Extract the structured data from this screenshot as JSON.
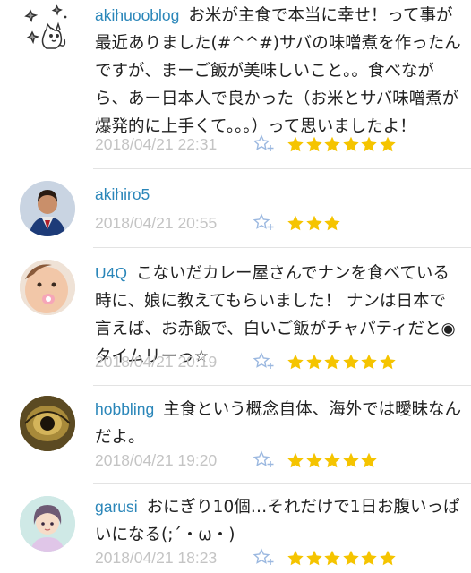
{
  "colors": {
    "username": "#2a86b9",
    "date": "#c4c4c4",
    "star": "#f5c400",
    "star_add": "#9bb8e0",
    "divider": "#e3e3e3"
  },
  "icons": {
    "add_star": "star-plus-icon",
    "rating_star": "star-icon"
  },
  "comments": [
    {
      "username": "akihuooblog",
      "text": "お米が主食で本当に幸せ！って事が最近ありました(#^^#)サバの味噌煮を作ったんですが、まーご飯が美味しいこと。。食べながら、あー日本人で良かった（お米とサバ味噌煮が爆発的に上手くて。。。）って思いましたよ！",
      "date": "2018/04/21 22:31",
      "stars": 6
    },
    {
      "username": "akihiro5",
      "text": "",
      "date": "2018/04/21 20:55",
      "stars": 3
    },
    {
      "username": "U4Q",
      "text": "こないだカレー屋さんでナンを食べている時に、娘に教えてもらいました！ ナンは日本で言えば、お赤飯で、白いご飯がチャパティだと◉ タイムリーっ☆",
      "date": "2018/04/21 20:19",
      "stars": 6
    },
    {
      "username": "hobbling",
      "text": "主食という概念自体、海外では曖昧なんだよ。",
      "date": "2018/04/21 19:20",
      "stars": 5
    },
    {
      "username": "garusi",
      "text": "おにぎり10個…それだけで1日お腹いっぱいになる(;´・ω・)",
      "date": "2018/04/21 18:23",
      "stars": 6
    }
  ]
}
